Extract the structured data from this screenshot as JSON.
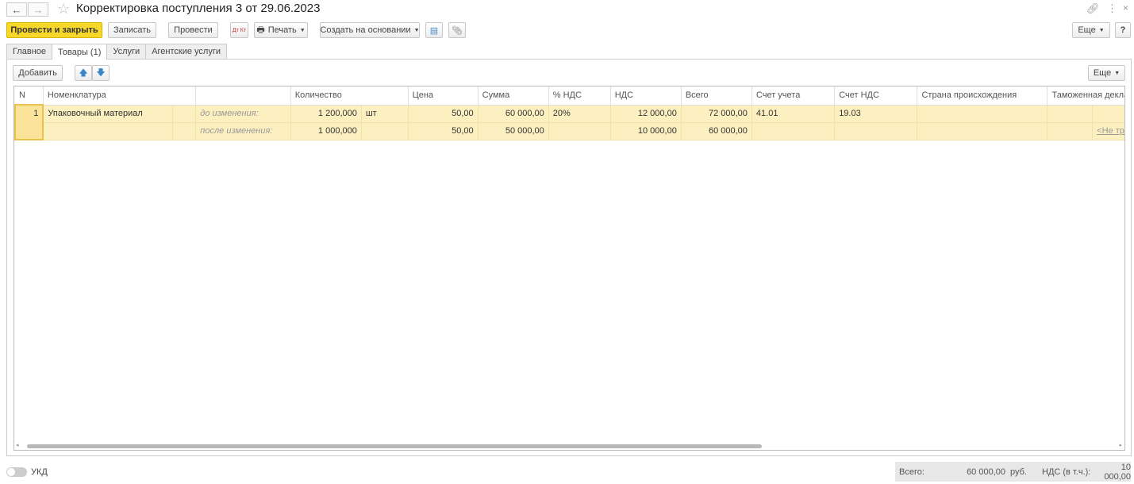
{
  "title": "Корректировка поступления 3 от 29.06.2023",
  "toolbar": {
    "post_close": "Провести и закрыть",
    "save": "Записать",
    "post": "Провести",
    "dtkt": "Дт Кт",
    "print": "Печать",
    "create_based": "Создать на основании",
    "more": "Еще",
    "help": "?"
  },
  "tabs": [
    "Главное",
    "Товары (1)",
    "Услуги",
    "Агентские услуги"
  ],
  "table_toolbar": {
    "add": "Добавить",
    "more": "Еще"
  },
  "columns": [
    "N",
    "Номенклатура",
    "",
    "Количество",
    "",
    "Цена",
    "Сумма",
    "% НДС",
    "НДС",
    "Всего",
    "Счет учета",
    "Счет НДС",
    "Страна происхождения",
    "Таможенная декларация"
  ],
  "rows": [
    {
      "n": "1",
      "item": "Упаковочный материал",
      "before_label": "до изменения:",
      "after_label": "после изменения:",
      "qty_before": "1 200,000",
      "qty_after": "1 000,000",
      "unit": "шт",
      "price_before": "50,00",
      "price_after": "50,00",
      "sum_before": "60 000,00",
      "sum_after": "50 000,00",
      "vat_rate": "20%",
      "vat_before": "12 000,00",
      "vat_after": "10 000,00",
      "total_before": "72 000,00",
      "total_after": "60 000,00",
      "account": "41.01",
      "vat_account": "19.03",
      "customs": "<Не требуется>"
    }
  ],
  "footer": {
    "ukd": "УКД",
    "total_label": "Всего:",
    "total": "60 000,00",
    "currency": "руб.",
    "vat_label": "НДС (в т.ч.):",
    "vat": "10 000,00"
  }
}
